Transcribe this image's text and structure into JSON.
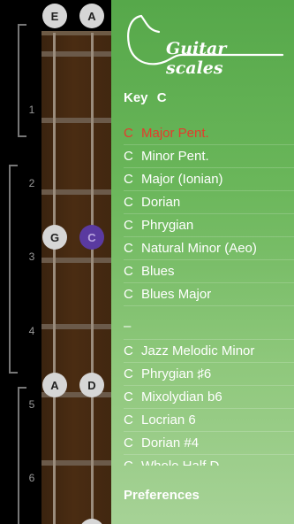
{
  "fretboard": {
    "open_strings": [
      "E",
      "A"
    ],
    "fret_numbers": [
      "1",
      "2",
      "3",
      "4",
      "5",
      "6"
    ],
    "notes_row_3": [
      "G",
      "C"
    ],
    "notes_row_5": [
      "A",
      "D"
    ]
  },
  "drawer": {
    "title": "Guitar scales",
    "key_label": "Key",
    "key_value": "C",
    "scales": [
      {
        "key": "C",
        "name": "Major Pent."
      },
      {
        "key": "C",
        "name": "Minor Pent."
      },
      {
        "key": "C",
        "name": "Major (Ionian)"
      },
      {
        "key": "C",
        "name": "Dorian"
      },
      {
        "key": "C",
        "name": "Phrygian"
      },
      {
        "key": "C",
        "name": "Natural Minor (Aeo)"
      },
      {
        "key": "C",
        "name": "Blues"
      },
      {
        "key": "C",
        "name": "Blues Major"
      }
    ],
    "separator": "–",
    "scales2": [
      {
        "key": "C",
        "name": "Jazz Melodic Minor"
      },
      {
        "key": "C",
        "name": "Phrygian ♯6"
      },
      {
        "key": "C",
        "name": "Mixolydian b6"
      },
      {
        "key": "C",
        "name": "Locrian 6"
      },
      {
        "key": "C",
        "name": "Dorian #4"
      },
      {
        "key": "C",
        "name": "Whole Half D..."
      }
    ],
    "preferences_label": "Preferences"
  },
  "colors": {
    "selected": "#e53b2c",
    "root_note": "#5a3aa0",
    "drawer_green": "#56a84a"
  }
}
